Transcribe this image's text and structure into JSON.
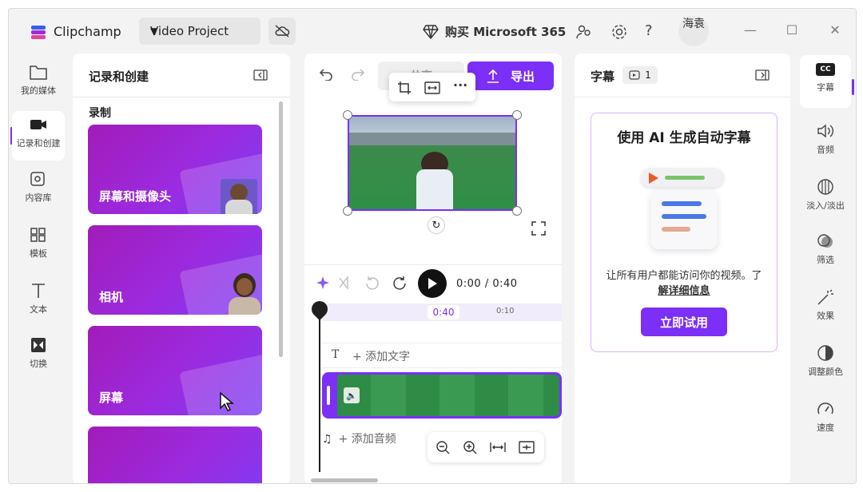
{
  "app": {
    "name": "Clipchamp",
    "project_name": "Video Project",
    "buy_label": "购买 Microsoft 365",
    "avatar_text": "海袁"
  },
  "left_rail": [
    {
      "label": "我的媒体",
      "icon": "folder-icon"
    },
    {
      "label": "记录和创建",
      "icon": "camera-icon",
      "active": true
    },
    {
      "label": "内容库",
      "icon": "library-icon"
    },
    {
      "label": "模板",
      "icon": "templates-icon"
    },
    {
      "label": "文本",
      "icon": "text-icon"
    },
    {
      "label": "切换",
      "icon": "transitions-icon"
    }
  ],
  "record_panel": {
    "title": "记录和创建",
    "section": "录制",
    "cards": [
      {
        "label": "屏幕和摄像头"
      },
      {
        "label": "相机"
      },
      {
        "label": "屏幕"
      },
      {
        "label": ""
      }
    ]
  },
  "editor": {
    "share_label": "共享",
    "export_label": "导出",
    "time_current": "0:00",
    "time_total": "0:40",
    "ruler_marks": [
      "0:40",
      "0:10"
    ],
    "add_text_label": "+ 添加文字",
    "add_audio_label": "+ 添加音频"
  },
  "captions_panel": {
    "title": "字幕",
    "count": "1",
    "promo_title": "使用 AI 生成自动字幕",
    "promo_desc": "让所有用户都能访问你的视频。了",
    "promo_link": "解详细信息",
    "try_label": "立即试用"
  },
  "right_rail": [
    {
      "label": "字幕",
      "icon": "captions-icon",
      "active": true
    },
    {
      "label": "音频",
      "icon": "speaker-icon"
    },
    {
      "label": "淡入/淡出",
      "icon": "fade-icon"
    },
    {
      "label": "筛选",
      "icon": "filters-icon"
    },
    {
      "label": "效果",
      "icon": "effects-icon"
    },
    {
      "label": "调整颜色",
      "icon": "color-adjust-icon"
    },
    {
      "label": "速度",
      "icon": "speed-icon"
    }
  ],
  "colors": {
    "accent": "#7b2ff7",
    "card": "#9b2be0"
  }
}
